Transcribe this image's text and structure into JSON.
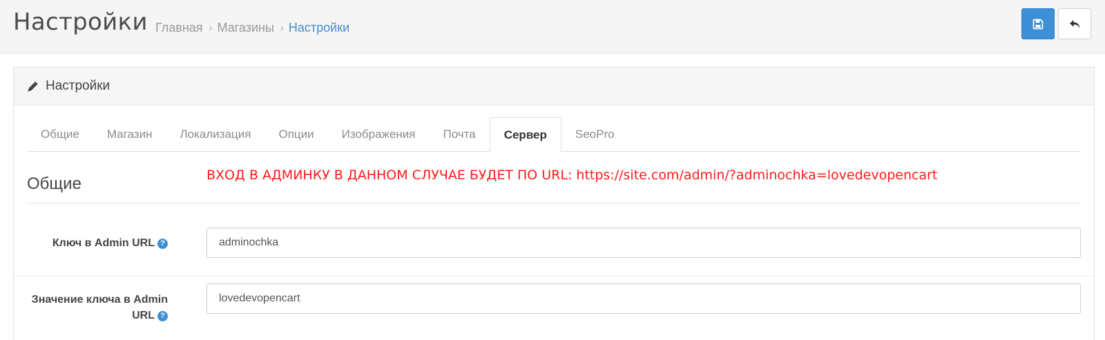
{
  "header": {
    "title": "Настройки",
    "breadcrumb": [
      {
        "label": "Главная"
      },
      {
        "label": "Магазины"
      },
      {
        "label": "Настройки"
      }
    ],
    "breadcrumb_sep": "›",
    "save_icon": "floppy-disk-icon",
    "back_icon": "reply-arrow-icon"
  },
  "panel": {
    "icon": "pencil-icon",
    "title": "Настройки"
  },
  "tabs": [
    {
      "label": "Общие"
    },
    {
      "label": "Магазин"
    },
    {
      "label": "Локализация"
    },
    {
      "label": "Опции"
    },
    {
      "label": "Изображения"
    },
    {
      "label": "Почта"
    },
    {
      "label": "Сервер"
    },
    {
      "label": "SeoPro"
    }
  ],
  "active_tab": "Сервер",
  "section": {
    "legend": "Общие",
    "notice": "ВХОД В АДМИНКУ В ДАННОМ СЛУЧАЕ БУДЕТ ПО URL: https://site.com/admin/?adminochka=lovedevopencart"
  },
  "fields": [
    {
      "label": "Ключ в Admin URL",
      "value": "adminochka"
    },
    {
      "label_line1": "Значение ключа в Admin",
      "label_line2": "URL",
      "value": "lovedevopencart"
    }
  ],
  "help_glyph": "?",
  "colors": {
    "accent": "#3d8fd6",
    "notice": "#ff1a1a",
    "active_crumb": "#4a8ccf"
  }
}
